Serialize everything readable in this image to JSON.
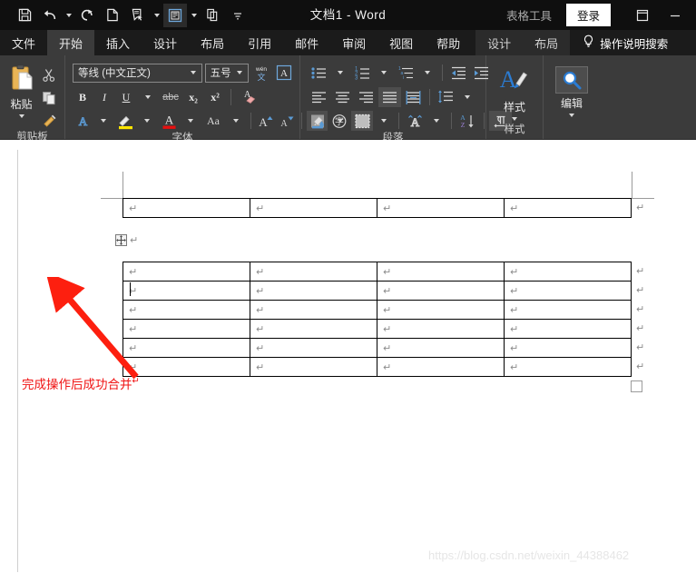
{
  "window": {
    "title": "文档1  -  Word",
    "contextual_tools": "表格工具",
    "signin_label": "登录",
    "restore_icon": "restore-window-icon",
    "minimize_icon": "minimize-window-icon"
  },
  "quick_access": [
    {
      "name": "save-icon",
      "label": "保存"
    },
    {
      "name": "undo-icon",
      "label": "撤消"
    },
    {
      "name": "redo-icon",
      "label": "重复"
    },
    {
      "name": "new-document-icon",
      "label": "新建"
    },
    {
      "name": "touch-mode-icon",
      "label": "触摸/鼠标模式"
    },
    {
      "name": "print-preview-icon",
      "label": "打印预览和打印"
    },
    {
      "name": "copy-icon",
      "label": "复制"
    },
    {
      "name": "customize-qat-icon",
      "label": "自定义快速访问工具栏"
    }
  ],
  "tabs": {
    "main": [
      "文件",
      "开始",
      "插入",
      "设计",
      "布局",
      "引用",
      "邮件",
      "审阅",
      "视图",
      "帮助"
    ],
    "active": "开始",
    "contextual": [
      "设计",
      "布局"
    ],
    "tellme": "操作说明搜索",
    "tellme_icon": "lightbulb-icon"
  },
  "ribbon": {
    "clipboard": {
      "label": "剪贴板",
      "paste_label": "粘贴",
      "paste_icon": "clipboard-paste-icon",
      "cut_icon": "scissors-icon",
      "copy_icon": "copy-icon",
      "format_painter_icon": "format-painter-icon",
      "dialog_launcher": "dialog-launcher-icon"
    },
    "font": {
      "label": "字体",
      "font_family_value": "等线 (中文正文)",
      "font_size_value": "五号",
      "phonetic_guide_icon": "phonetic-guide-icon",
      "character_border_icon": "character-border-icon",
      "bold": "B",
      "italic": "I",
      "underline": "U",
      "strikethrough": "abc",
      "subscript": "x₂",
      "superscript": "x²",
      "clear_format_icon": "clear-formatting-icon",
      "text_effects_icon": "text-effects-icon",
      "highlight_icon": "text-highlight-icon",
      "font_color_icon": "font-color-icon",
      "change_case_label": "Aa",
      "grow_font_icon": "grow-font-icon",
      "shrink_font_icon": "shrink-font-icon",
      "char_shading_icon": "character-shading-icon",
      "enclose_char_icon": "enclose-characters-icon",
      "highlight_color": "#ffe600",
      "font_color": "#e81010",
      "dialog_launcher": "dialog-launcher-icon"
    },
    "paragraph": {
      "label": "段落",
      "bullets_icon": "bullet-list-icon",
      "numbering_icon": "numbered-list-icon",
      "multilevel_icon": "multilevel-list-icon",
      "decrease_indent_icon": "decrease-indent-icon",
      "increase_indent_icon": "increase-indent-icon",
      "align_left_icon": "align-left-icon",
      "align_center_icon": "align-center-icon",
      "align_right_icon": "align-right-icon",
      "justify_icon": "justify-icon",
      "distribute_icon": "distribute-text-icon",
      "line_spacing_icon": "line-spacing-icon",
      "shading_icon": "shading-icon",
      "borders_icon": "borders-icon",
      "asian_layout_icon": "asian-layout-icon",
      "sort_icon": "sort-icon",
      "show_marks_icon": "show-formatting-marks-icon",
      "dialog_launcher": "dialog-launcher-icon"
    },
    "styles": {
      "label": "样式",
      "button_label": "样式",
      "icon": "styles-gallery-icon",
      "dialog_launcher": "dialog-launcher-icon"
    },
    "editing": {
      "label": "编辑",
      "button_label": "编辑",
      "icon": "find-search-icon"
    }
  },
  "document": {
    "table_move_handle_icon": "table-move-handle-icon",
    "cell_mark": "↵",
    "end_of_row_mark": "↵",
    "paragraph_mark": "↵",
    "annotation": "完成操作后成功合并",
    "annotation_color": "#f01414",
    "table_top": {
      "columns": 4,
      "rows": 1,
      "cells": [
        [
          "↵",
          "↵",
          "↵",
          "↵"
        ]
      ]
    },
    "table_bottom": {
      "columns": 4,
      "rows": 6,
      "cells": [
        [
          "↵",
          "↵",
          "↵",
          "↵"
        ],
        [
          "↵",
          "↵",
          "↵",
          "↵"
        ],
        [
          "↵",
          "↵",
          "↵",
          "↵"
        ],
        [
          "↵",
          "↵",
          "↵",
          "↵"
        ],
        [
          "↵",
          "↵",
          "↵",
          "↵"
        ],
        [
          "↵",
          "↵",
          "↵",
          "↵"
        ]
      ]
    },
    "watermark": "https://blog.csdn.net/weixin_44388462"
  }
}
